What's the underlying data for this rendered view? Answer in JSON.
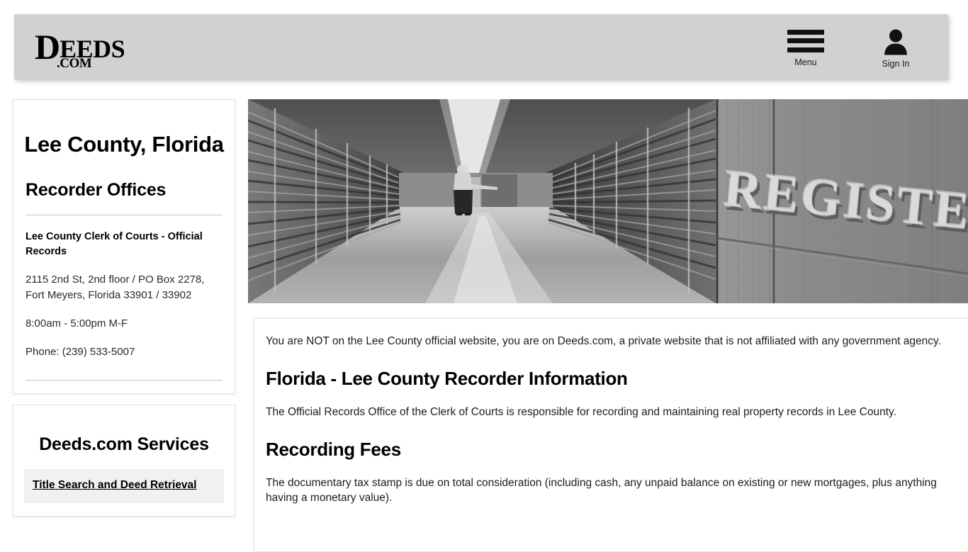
{
  "header": {
    "logo": {
      "d": "D",
      "eeds": "EEDS",
      "com": ".COM",
      "alt": "Deeds.com"
    },
    "menu_label": "Menu",
    "menu_icon": "hamburger-icon",
    "signin_label": "Sign In",
    "signin_icon": "user-icon",
    "background_color": "#d1d1d1"
  },
  "sidebar": {
    "county_title": "Lee County, Florida",
    "recorder_offices_heading": "Recorder Offices",
    "office": {
      "name": "Lee County Clerk of Courts - Official Records",
      "address": "2115 2nd St, 2nd floor / PO Box 2278, Fort Meyers, Florida 33901 / 33902",
      "hours": "8:00am - 5:00pm M-F",
      "phone": "Phone: (239) 533-5007"
    },
    "services_heading": "Deeds.com Services",
    "services": [
      {
        "label": "Title Search and Deed Retrieval"
      }
    ]
  },
  "hero": {
    "alt": "Register of Deeds archive room with rows of record shelving",
    "sign_text": "REGISTER OF DEEDS"
  },
  "main": {
    "disclaimer": "You are NOT on the Lee County official website, you are on Deeds.com, a private website that is not affiliated with any government agency.",
    "heading_recorder_info": "Florida - Lee County Recorder Information",
    "paragraph_recorder_info": "The Official Records Office of the Clerk of Courts is responsible for recording and maintaining real property records in Lee County.",
    "heading_recording_fees": "Recording Fees",
    "paragraph_recording_fees": "The documentary tax stamp is due on total consideration (including cash, any unpaid balance on existing or new mortgages, plus anything having a monetary value)."
  }
}
